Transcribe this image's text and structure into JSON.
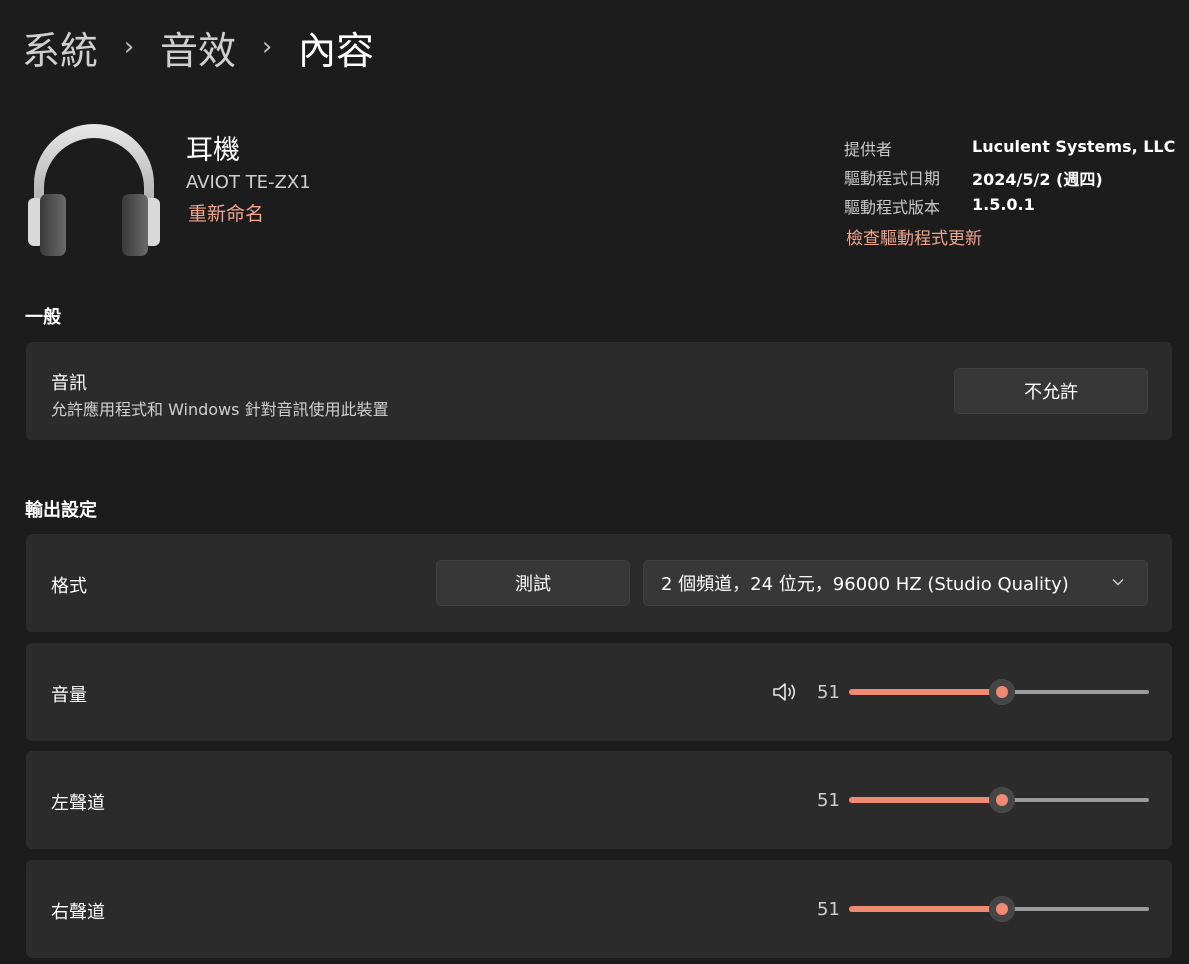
{
  "breadcrumb": {
    "items": [
      "系統",
      "音效",
      "內容"
    ],
    "separator": "›"
  },
  "device": {
    "icon": "headphones-icon",
    "name": "耳機",
    "model": "AVIOT TE-ZX1",
    "rename_link": "重新命名"
  },
  "driver_info": {
    "provider_label": "提供者",
    "provider_value": "Luculent Systems, LLC",
    "date_label": "驅動程式日期",
    "date_value": "2024/5/2 (週四)",
    "version_label": "驅動程式版本",
    "version_value": "1.5.0.1",
    "update_link": "檢查驅動程式更新"
  },
  "general": {
    "title": "一般",
    "audio": {
      "title": "音訊",
      "description": "允許應用程式和 Windows 針對音訊使用此裝置",
      "button_label": "不允許"
    }
  },
  "output": {
    "title": "輸出設定",
    "format": {
      "label": "格式",
      "test_button": "測試",
      "selected": "2 個頻道，24 位元，96000 HZ (Studio Quality)"
    },
    "volume": {
      "label": "音量",
      "value": "51",
      "level": 0.51,
      "icon": "speaker-icon"
    },
    "left_channel": {
      "label": "左聲道",
      "value": "51",
      "level": 0.51
    },
    "right_channel": {
      "label": "右聲道",
      "value": "51",
      "level": 0.51
    }
  },
  "colors": {
    "background": "#1c1c1c",
    "card": "#2b2b2b",
    "accent": "#f08a70",
    "link": "#f2a48c"
  }
}
